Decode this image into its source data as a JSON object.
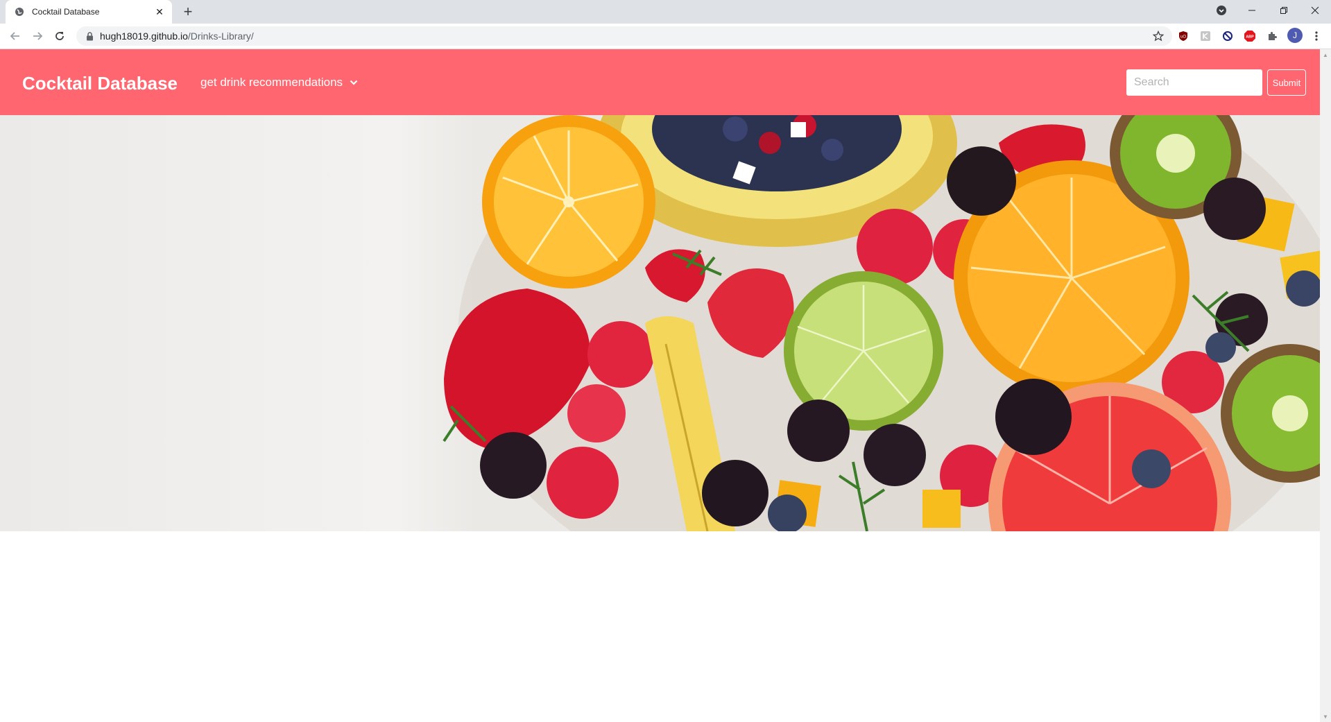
{
  "browser": {
    "tab": {
      "title": "Cocktail Database"
    },
    "url": {
      "host": "hugh18019.github.io",
      "path": "/Drinks-Library/"
    },
    "extensions": [
      "ublock-icon",
      "extension-icon",
      "block-icon",
      "adblock-plus-icon",
      "puzzle-icon"
    ],
    "profile_initial": "J"
  },
  "navbar": {
    "brand": "Cocktail Database",
    "dropdown_label": "get drink recommendations",
    "search_placeholder": "Search",
    "submit_label": "Submit",
    "background_color": "#ff6670"
  },
  "hero": {
    "image": "fruit-assortment"
  }
}
